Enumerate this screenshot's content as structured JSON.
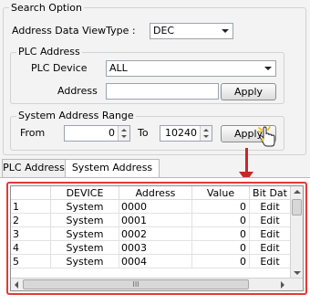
{
  "search_option": {
    "title": "Search Option",
    "address_view_label": "Address Data  ViewType :",
    "view_type_value": "DEC"
  },
  "plc_address": {
    "title": "PLC Address",
    "device_label": "PLC Device",
    "device_value": "ALL",
    "address_label": "Address",
    "address_value": "",
    "apply_label": "Apply"
  },
  "system_range": {
    "title": "System Address Range",
    "from_label": "From",
    "from_value": "0",
    "to_label": "To",
    "to_value": "10240",
    "apply_label": "Apply"
  },
  "tabs": [
    "PLC Address",
    "System Address"
  ],
  "grid": {
    "columns": [
      "DEVICE",
      "Address",
      "Value",
      "Bit Dat"
    ],
    "rows": [
      {
        "num": "1",
        "device": "System",
        "address": "0000",
        "value": "0",
        "bit": "Edit"
      },
      {
        "num": "2",
        "device": "System",
        "address": "0001",
        "value": "0",
        "bit": "Edit"
      },
      {
        "num": "3",
        "device": "System",
        "address": "0002",
        "value": "0",
        "bit": "Edit"
      },
      {
        "num": "4",
        "device": "System",
        "address": "0003",
        "value": "0",
        "bit": "Edit"
      },
      {
        "num": "5",
        "device": "System",
        "address": "0004",
        "value": "0",
        "bit": "Edit"
      }
    ],
    "hscroll_grip": "III"
  },
  "colors": {
    "highlight": "#e53935",
    "arrow": "#c62828"
  }
}
